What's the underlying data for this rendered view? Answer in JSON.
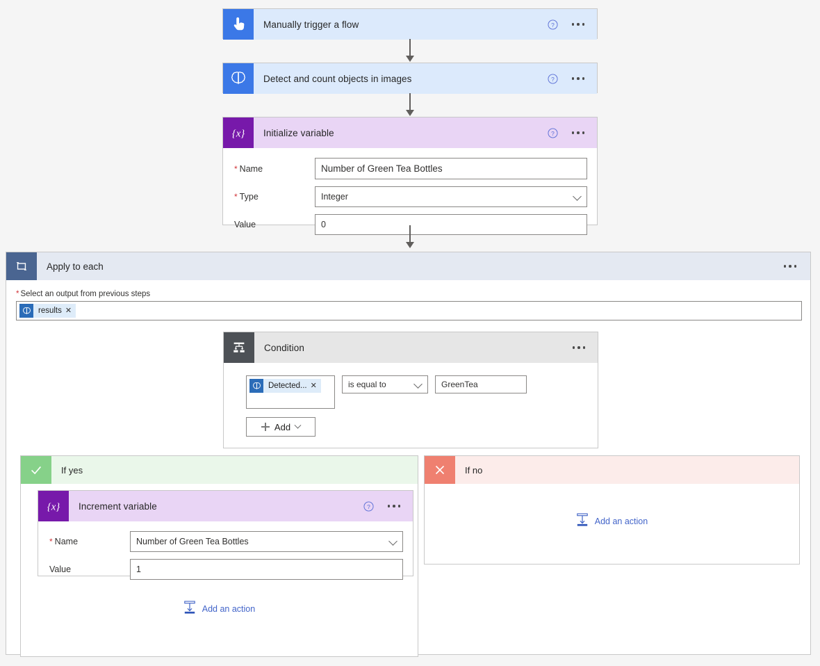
{
  "theme": {
    "canvas_bg": "#f5f5f5",
    "trigger_tile": "#3b78e7",
    "trigger_head": "#dceafc",
    "variable_tile": "#7719aa",
    "variable_head": "#e9d5f5",
    "condition_tile": "#4d5156",
    "condition_head": "#e6e6e6",
    "loop_tile": "#4a6591",
    "loop_head": "#e4e9f2",
    "yes_tile": "#86d189",
    "yes_head": "#eaf7ea",
    "no_tile": "#ef8070",
    "no_head": "#fcecea",
    "link_blue": "#4264c9",
    "required_red": "#d13438"
  },
  "steps": {
    "trigger": {
      "title": "Manually trigger a flow",
      "icon": "touch-tap-icon",
      "help_icon": "help-circle-icon",
      "menu_icon": "ellipsis-icon"
    },
    "detect": {
      "title": "Detect and count objects in images",
      "icon": "brain-ai-icon",
      "help_icon": "help-circle-icon",
      "menu_icon": "ellipsis-icon"
    },
    "initialize_variable": {
      "title": "Initialize variable",
      "icon": "variable-braces-icon",
      "help_icon": "help-circle-icon",
      "menu_icon": "ellipsis-icon",
      "fields": [
        {
          "label": "Name",
          "required": true,
          "value": "Number of Green Tea Bottles",
          "type": "text"
        },
        {
          "label": "Type",
          "required": true,
          "value": "Integer",
          "type": "dropdown"
        },
        {
          "label": "Value",
          "required": false,
          "value": "0",
          "type": "text"
        }
      ]
    },
    "apply_to_each": {
      "title": "Apply to each",
      "icon": "loop-repeat-icon",
      "menu_icon": "ellipsis-icon",
      "output_label": "Select an output from previous steps",
      "output_token": {
        "label": "results",
        "icon": "brain-ai-icon",
        "remove_icon": "close-x-icon"
      }
    },
    "condition": {
      "title": "Condition",
      "icon": "condition-branch-icon",
      "menu_icon": "ellipsis-icon",
      "left_token": {
        "label": "Detected...",
        "icon": "brain-ai-icon",
        "remove_icon": "close-x-icon"
      },
      "operator": "is equal to",
      "operator_icon": "chevron-down-icon",
      "right_value": "GreenTea",
      "add_button": {
        "label": "Add",
        "plus_icon": "plus-icon",
        "chevron_icon": "chevron-down-icon"
      }
    },
    "branch_yes": {
      "title": "If yes",
      "icon": "check-icon",
      "add_action": {
        "label": "Add an action",
        "icon": "add-action-icon"
      }
    },
    "branch_no": {
      "title": "If no",
      "icon": "close-x-icon",
      "add_action": {
        "label": "Add an action",
        "icon": "add-action-icon"
      }
    },
    "increment_variable": {
      "title": "Increment variable",
      "icon": "variable-braces-icon",
      "help_icon": "help-circle-icon",
      "menu_icon": "ellipsis-icon",
      "fields": [
        {
          "label": "Name",
          "required": true,
          "value": "Number of Green Tea Bottles",
          "type": "dropdown"
        },
        {
          "label": "Value",
          "required": false,
          "value": "1",
          "type": "text"
        }
      ]
    }
  }
}
